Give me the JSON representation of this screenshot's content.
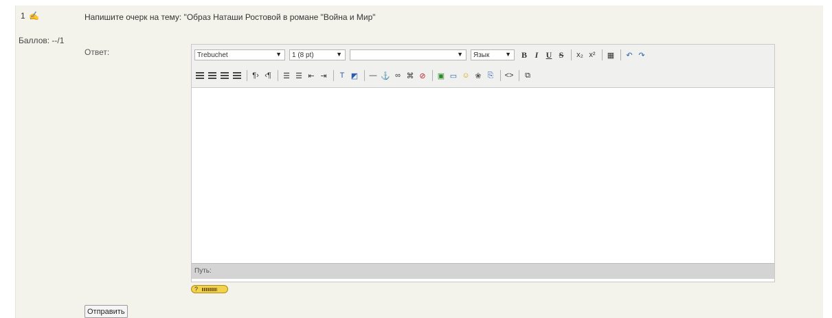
{
  "question": {
    "number": "1",
    "icon": "edit-icon",
    "score": "Баллов: --/1",
    "text": "Напишите очерк на тему: \"Образ Наташи Ростовой в романе \"Война и Мир\""
  },
  "answer_label": "Ответ:",
  "editor": {
    "font_family": "Trebuchet",
    "font_size": "1 (8 pt)",
    "format": "",
    "language": "Язык",
    "path_label": "Путь:"
  },
  "help_badge": "?",
  "submit_label": "Отправить"
}
